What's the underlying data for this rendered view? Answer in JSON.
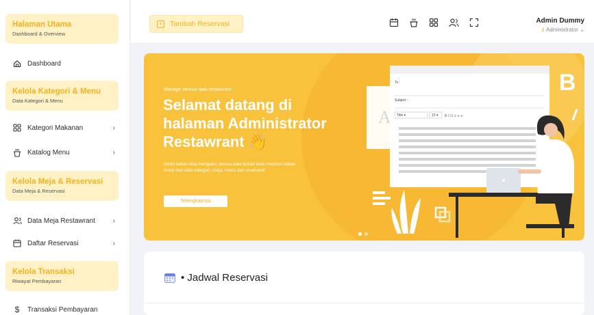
{
  "sidebar": {
    "sections": [
      {
        "title": "Halaman Utama",
        "subtitle": "Dashboard & Overview"
      },
      {
        "title": "Kelola Kategori & Menu",
        "subtitle": "Data Kategori & Menu"
      },
      {
        "title": "Kelola Meja & Reservasi",
        "subtitle": "Data Meja & Reservasi"
      },
      {
        "title": "Kelola Transaksi",
        "subtitle": "Riwayat Pembayaran"
      }
    ],
    "items": [
      {
        "label": "Dashboard",
        "icon": "home-icon"
      },
      {
        "label": "Kategori Makanan",
        "icon": "grid-icon"
      },
      {
        "label": "Katalog Menu",
        "icon": "cup-icon"
      },
      {
        "label": "Data Meja Restawrant",
        "icon": "users-icon"
      },
      {
        "label": "Daftar Reservasi",
        "icon": "calendar-icon"
      },
      {
        "label": "Transaksi Pembayaran",
        "icon": "dollar-icon"
      }
    ],
    "chevron": "›"
  },
  "header": {
    "add_button_label": "Tambah Reservasi",
    "icons": [
      "calendar-icon",
      "cup-icon",
      "grid-icon",
      "users-icon",
      "fullscreen-icon"
    ],
    "user_name": "Admin Dummy",
    "user_role": "Administrator ⌄"
  },
  "banner": {
    "tagline": "Manage semua data restawrant",
    "heading": "Selamat datang di halaman Administrator Restawrant 👋",
    "description": "Disini kalian bisa mengatur semua data terkait data restoran kalian mulai dari data kategori, meja, menu dan reservasi!",
    "button_label": "Selengkapnya",
    "mock_form": {
      "to_label": "To :",
      "subject_label": "Subject :",
      "font_select": "Title",
      "size_select": "12"
    }
  },
  "schedule": {
    "title": "• Jadwal Reservasi"
  },
  "colors": {
    "accent": "#f5b21c",
    "accent_light": "#fff1c6",
    "banner": "#f9c23c"
  }
}
